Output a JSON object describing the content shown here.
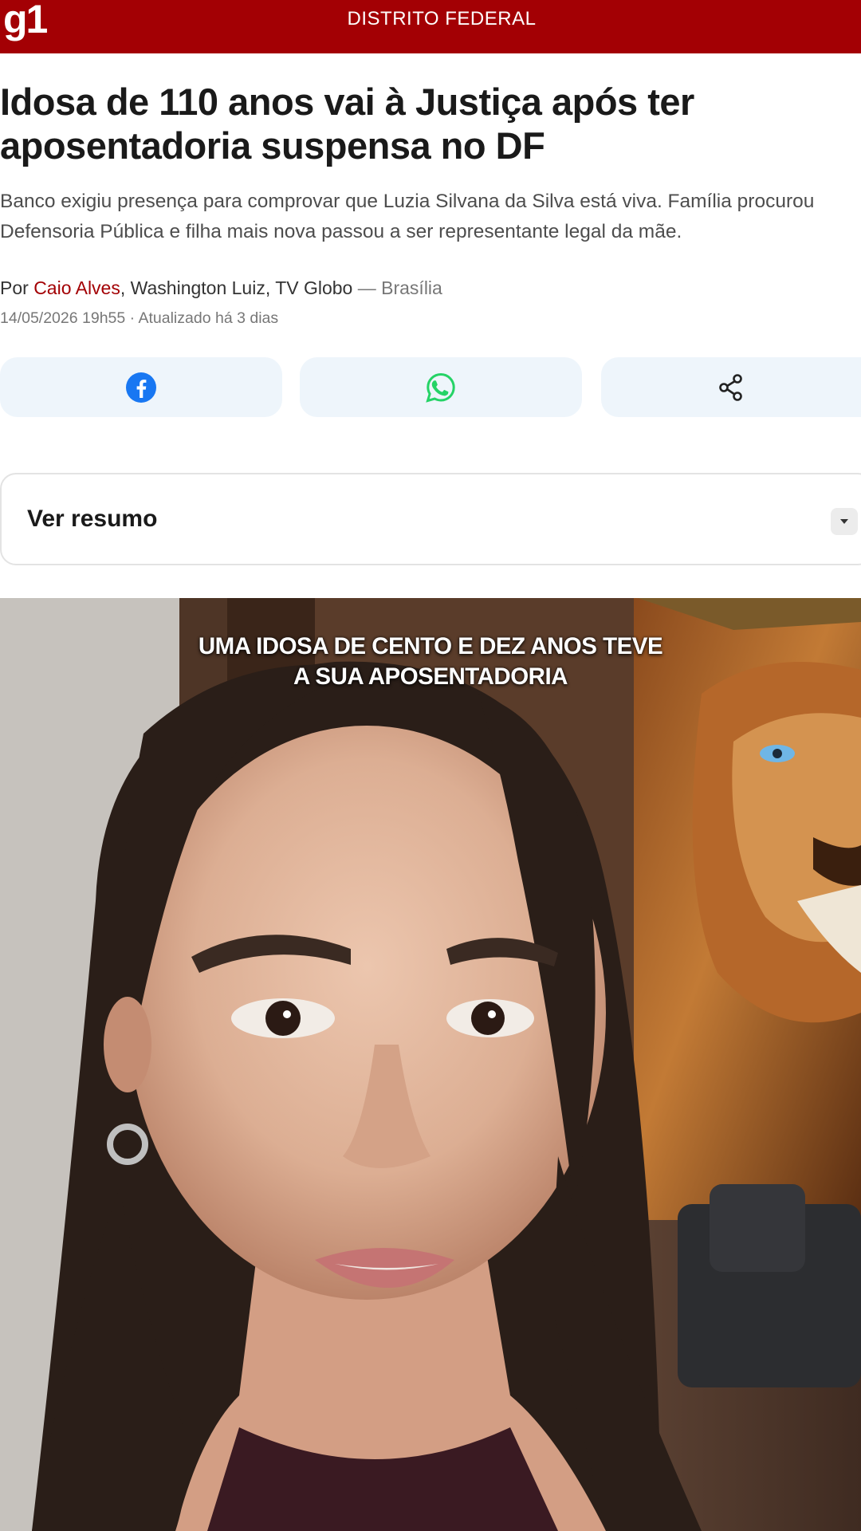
{
  "header": {
    "logo": "g1",
    "section": "DISTRITO FEDERAL",
    "brand_color": "#a30004"
  },
  "article": {
    "headline_line1": "Idosa de 110 anos vai à Justiça após ter",
    "headline_line2": "aposentadoria suspensa no DF",
    "subhead_line1": "Banco exigiu presença para comprovar que Luzia Silvana da Silva está viva. Família procurou",
    "subhead_line2": "Defensoria Pública e filha mais nova passou a ser representante legal da mãe.",
    "byline_prefix": "Por ",
    "byline_author_link": "Caio Alves",
    "byline_authors_rest": ", Washington Luiz, TV Globo",
    "byline_dash": " — ",
    "byline_place": "Brasília",
    "dateline": "14/05/2026 19h55 · Atualizado há 3 dias"
  },
  "share": {
    "facebook_icon": "facebook-icon",
    "whatsapp_icon": "whatsapp-icon",
    "share_icon": "share-icon",
    "facebook_color": "#1877f2",
    "whatsapp_color": "#25d366"
  },
  "summary": {
    "label": "Ver resumo",
    "toggle_icon": "caret-down-icon"
  },
  "video": {
    "caption_line1": "UMA IDOSA DE CENTO E DEZ ANOS TEVE",
    "caption_line2": "A SUA APOSENTADORIA"
  }
}
